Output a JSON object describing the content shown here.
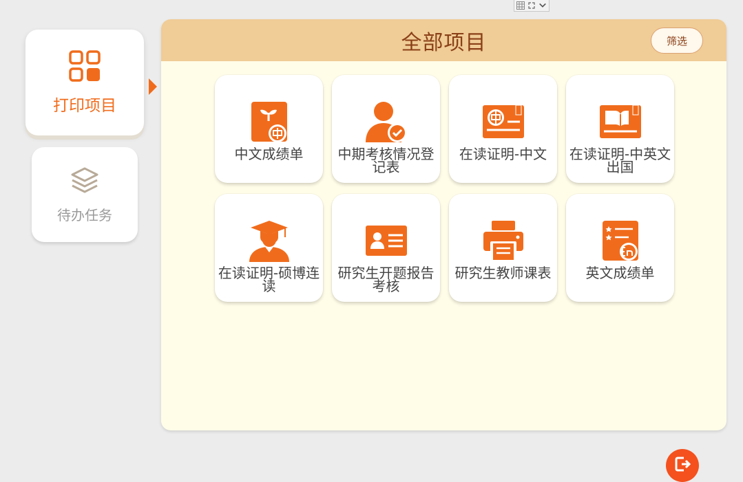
{
  "toolbar": {
    "icons": [
      "grid-icon",
      "expand-icon",
      "chevron-down-icon"
    ]
  },
  "nav": {
    "print_label": "打印项目",
    "task_label": "待办任务"
  },
  "panel": {
    "title": "全部项目",
    "filter_label": "筛选"
  },
  "tiles": [
    {
      "label": "中文成绩单",
      "icon": "chinese-transcript-icon"
    },
    {
      "label": "中期考核情况登记表",
      "icon": "user-check-icon"
    },
    {
      "label": "在读证明-中文",
      "icon": "chinese-certificate-icon"
    },
    {
      "label": "在读证明-中英文出国",
      "icon": "book-certificate-icon"
    },
    {
      "label": "在读证明-硕博连读",
      "icon": "graduate-icon"
    },
    {
      "label": "研究生开题报告考核",
      "icon": "id-card-icon"
    },
    {
      "label": "研究生教师课表",
      "icon": "printer-icon"
    },
    {
      "label": "英文成绩单",
      "icon": "english-transcript-icon"
    }
  ],
  "colors": {
    "accent": "#f06c1c",
    "header": "#f0cc96",
    "panel_bg": "#fffde8",
    "title": "#8a3f17",
    "logout": "#f4511e"
  },
  "logout": {
    "icon": "logout-icon"
  }
}
